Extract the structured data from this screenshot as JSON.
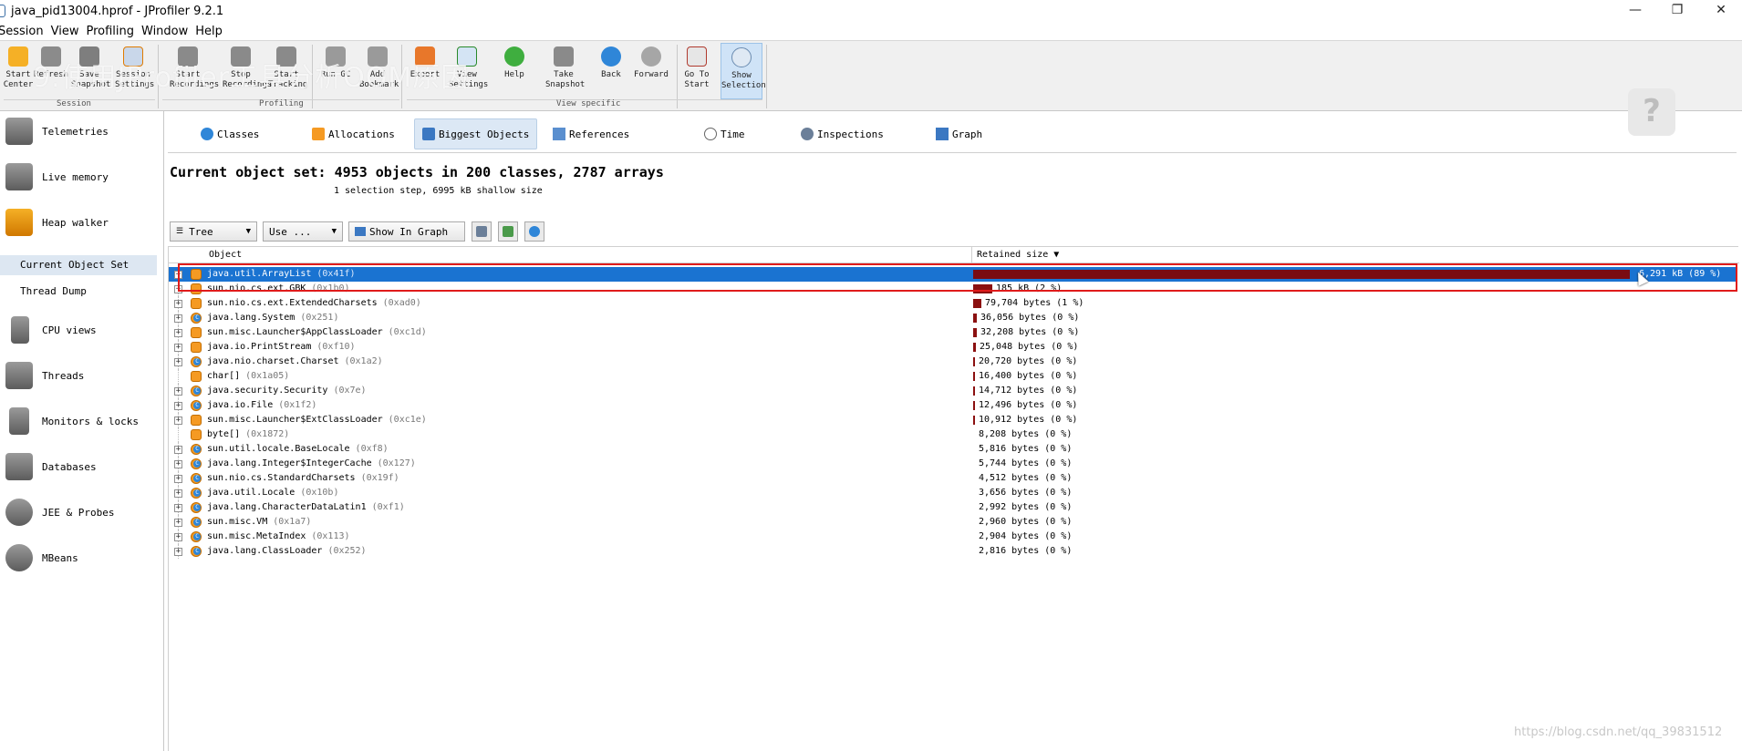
{
  "window": {
    "title": "java_pid13004.hprof - JProfiler 9.2.1",
    "controls": [
      "—",
      "❐",
      "✕"
    ]
  },
  "menu": [
    "Session",
    "View",
    "Profiling",
    "Window",
    "Help"
  ],
  "toolbar": {
    "session_buttons": [
      "Start Center",
      "Refresh",
      "Save Snapshot",
      "Session Settings"
    ],
    "profiling_buttons": [
      "Start Recordings",
      "Stop Recordings",
      "Start Tracking",
      "Run GC",
      "Add Bookmark"
    ],
    "view_buttons": [
      "Export",
      "View Settings",
      "Help",
      "Take Snapshot",
      "Back",
      "Forward",
      "Go To Start",
      "Show Selection"
    ],
    "groups": [
      "Session",
      "Profiling",
      "View specific"
    ],
    "overlay_text": "9.使用JProfiler工具分析OOM原因",
    "help_bubble": "?"
  },
  "sidebar": {
    "items": [
      "Telemetries",
      "Live memory",
      "Heap walker",
      "CPU views",
      "Threads",
      "Monitors & locks",
      "Databases",
      "JEE & Probes",
      "MBeans"
    ],
    "subitems": [
      "Current Object Set",
      "Thread Dump"
    ]
  },
  "view_tabs": [
    "Classes",
    "Allocations",
    "Biggest Objects",
    "References",
    "Time",
    "Inspections",
    "Graph"
  ],
  "object_set": {
    "title": "Current object set: 4953 objects in 200 classes, 2787 arrays",
    "subtitle": "1 selection step, 6995 kB shallow size"
  },
  "controls": {
    "view_mode": "Tree",
    "use": "Use ...",
    "show_in_graph": "Show In Graph"
  },
  "table": {
    "headers": {
      "object": "Object",
      "size": "Retained size ▼"
    },
    "rows": [
      {
        "name": "java.util.ArrayList",
        "id": "(0x41f)",
        "size": "6,291 kB (89 %)",
        "fraction": 0.89,
        "kind": "obj",
        "expandable": true
      },
      {
        "name": "sun.nio.cs.ext.GBK",
        "id": "(0x1b0)",
        "size": "185 kB (2 %)",
        "fraction": 0.026,
        "kind": "obj",
        "expandable": true
      },
      {
        "name": "sun.nio.cs.ext.ExtendedCharsets",
        "id": "(0xad0)",
        "size": "79,704 bytes (1 %)",
        "fraction": 0.011,
        "kind": "obj",
        "expandable": true
      },
      {
        "name": "java.lang.System",
        "id": "(0x251)",
        "size": "36,056 bytes (0 %)",
        "fraction": 0.005,
        "kind": "cls",
        "expandable": true
      },
      {
        "name": "sun.misc.Launcher$AppClassLoader",
        "id": "(0xc1d)",
        "size": "32,208 bytes (0 %)",
        "fraction": 0.0045,
        "kind": "obj",
        "expandable": true
      },
      {
        "name": "java.io.PrintStream",
        "id": "(0xf10)",
        "size": "25,048 bytes (0 %)",
        "fraction": 0.0035,
        "kind": "obj",
        "expandable": true
      },
      {
        "name": "java.nio.charset.Charset",
        "id": "(0x1a2)",
        "size": "20,720 bytes (0 %)",
        "fraction": 0.003,
        "kind": "cls",
        "expandable": true
      },
      {
        "name": "char[]",
        "id": "(0x1a05)",
        "size": "16,400 bytes (0 %)",
        "fraction": 0.0023,
        "kind": "obj",
        "expandable": false
      },
      {
        "name": "java.security.Security",
        "id": "(0x7e)",
        "size": "14,712 bytes (0 %)",
        "fraction": 0.002,
        "kind": "cls",
        "expandable": true
      },
      {
        "name": "java.io.File",
        "id": "(0x1f2)",
        "size": "12,496 bytes (0 %)",
        "fraction": 0.0018,
        "kind": "cls",
        "expandable": true
      },
      {
        "name": "sun.misc.Launcher$ExtClassLoader",
        "id": "(0xc1e)",
        "size": "10,912 bytes (0 %)",
        "fraction": 0.0015,
        "kind": "obj",
        "expandable": true
      },
      {
        "name": "byte[]",
        "id": "(0x1872)",
        "size": "8,208 bytes (0 %)",
        "fraction": 0.0,
        "kind": "obj",
        "expandable": false
      },
      {
        "name": "sun.util.locale.BaseLocale",
        "id": "(0xf8)",
        "size": "5,816 bytes (0 %)",
        "fraction": 0.0,
        "kind": "cls",
        "expandable": true
      },
      {
        "name": "java.lang.Integer$IntegerCache",
        "id": "(0x127)",
        "size": "5,744 bytes (0 %)",
        "fraction": 0.0,
        "kind": "cls",
        "expandable": true
      },
      {
        "name": "sun.nio.cs.StandardCharsets",
        "id": "(0x19f)",
        "size": "4,512 bytes (0 %)",
        "fraction": 0.0,
        "kind": "cls",
        "expandable": true
      },
      {
        "name": "java.util.Locale",
        "id": "(0x10b)",
        "size": "3,656 bytes (0 %)",
        "fraction": 0.0,
        "kind": "cls",
        "expandable": true
      },
      {
        "name": "java.lang.CharacterDataLatin1",
        "id": "(0xf1)",
        "size": "2,992 bytes (0 %)",
        "fraction": 0.0,
        "kind": "cls",
        "expandable": true
      },
      {
        "name": "sun.misc.VM",
        "id": "(0x1a7)",
        "size": "2,960 bytes (0 %)",
        "fraction": 0.0,
        "kind": "cls",
        "expandable": true
      },
      {
        "name": "sun.misc.MetaIndex",
        "id": "(0x113)",
        "size": "2,904 bytes (0 %)",
        "fraction": 0.0,
        "kind": "cls",
        "expandable": true
      },
      {
        "name": "java.lang.ClassLoader",
        "id": "(0x252)",
        "size": "2,816 bytes (0 %)",
        "fraction": 0.0,
        "kind": "cls",
        "expandable": true
      }
    ]
  },
  "source_watermark": "https://blog.csdn.net/qq_39831512",
  "colors": {
    "selection": "#1a73d1",
    "bar": "#8b1010",
    "highlight_box": "#e01b1b",
    "accent_orange": "#f59a23"
  }
}
